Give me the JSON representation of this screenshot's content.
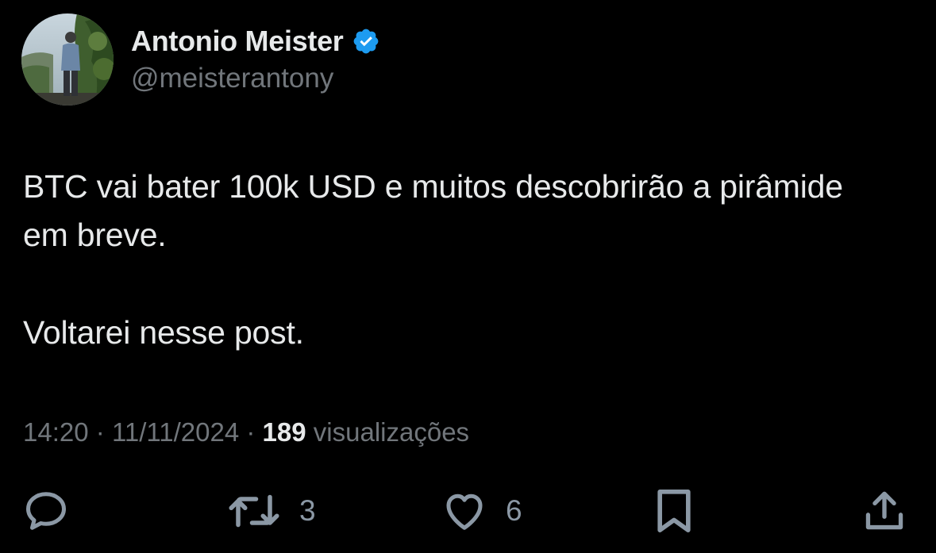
{
  "author": {
    "display_name": "Antonio Meister",
    "handle": "@meisterantony",
    "verified": true,
    "verified_color": "#1d9bf0"
  },
  "post": {
    "paragraphs": [
      "BTC vai bater 100k USD e muitos descobrirão a pirâmide em breve.",
      "Voltarei nesse post."
    ]
  },
  "meta": {
    "time": "14:20",
    "separator": "·",
    "date": "11/11/2024",
    "views_count": "189",
    "views_label": "visualizações"
  },
  "actions": {
    "reply": {
      "icon": "reply-icon",
      "count": ""
    },
    "retweet": {
      "icon": "retweet-icon",
      "count": "3"
    },
    "like": {
      "icon": "heart-icon",
      "count": "6"
    },
    "bookmark": {
      "icon": "bookmark-icon",
      "count": ""
    },
    "share": {
      "icon": "share-icon",
      "count": ""
    }
  },
  "colors": {
    "background": "#000000",
    "primary_text": "#e7e9ea",
    "secondary_text": "#71767b",
    "icon": "#8b98a5"
  }
}
